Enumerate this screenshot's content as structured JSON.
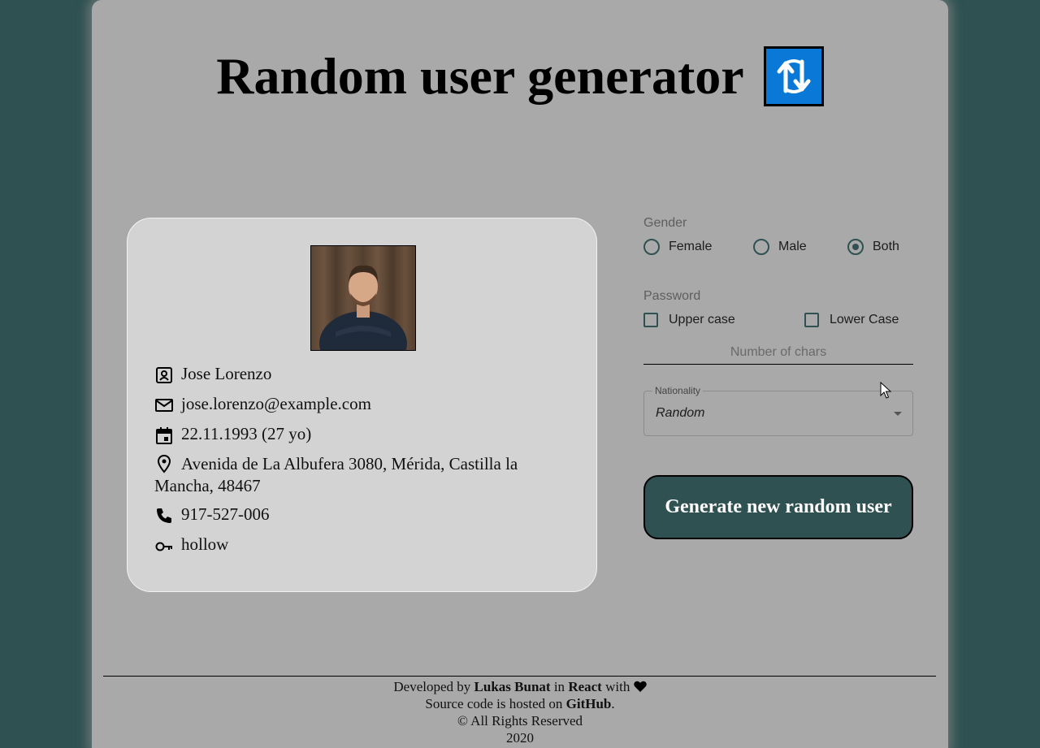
{
  "header": {
    "title": "Random user generator",
    "logo_icon": "refresh-arrows-icon",
    "logo_color": "#0a78d7"
  },
  "user": {
    "name": "Jose Lorenzo",
    "email": "jose.lorenzo@example.com",
    "birthday": "22.11.1993 (27 yo)",
    "address": "Avenida de La Albufera 3080, Mérida, Castilla la Mancha, 48467",
    "phone": "917-527-006",
    "password": "hollow",
    "icons": [
      "contact-card-icon",
      "mail-icon",
      "calendar-icon",
      "location-pin-icon",
      "phone-icon",
      "key-icon"
    ]
  },
  "controls": {
    "gender_label": "Gender",
    "gender_options": [
      "Female",
      "Male",
      "Both"
    ],
    "gender_selected": "Both",
    "password_label": "Password",
    "password_options": [
      "Upper case",
      "Lower Case"
    ],
    "chars_placeholder": "Number of chars",
    "nationality_label": "Nationality",
    "nationality_value": "Random",
    "generate_label": "Generate new random user"
  },
  "footer": {
    "developed_by": "Developed by",
    "author": "Lukas Bunat",
    "in": "in",
    "framework": "React",
    "with": "with",
    "source_prefix": "Source code is hosted on",
    "host": "GitHub",
    "rights": "© All Rights Reserved",
    "year": "2020"
  },
  "colors": {
    "background": "#2f5152",
    "page": "#a9a9a9",
    "card": "#d3d3d3",
    "accent": "#2f5152"
  }
}
